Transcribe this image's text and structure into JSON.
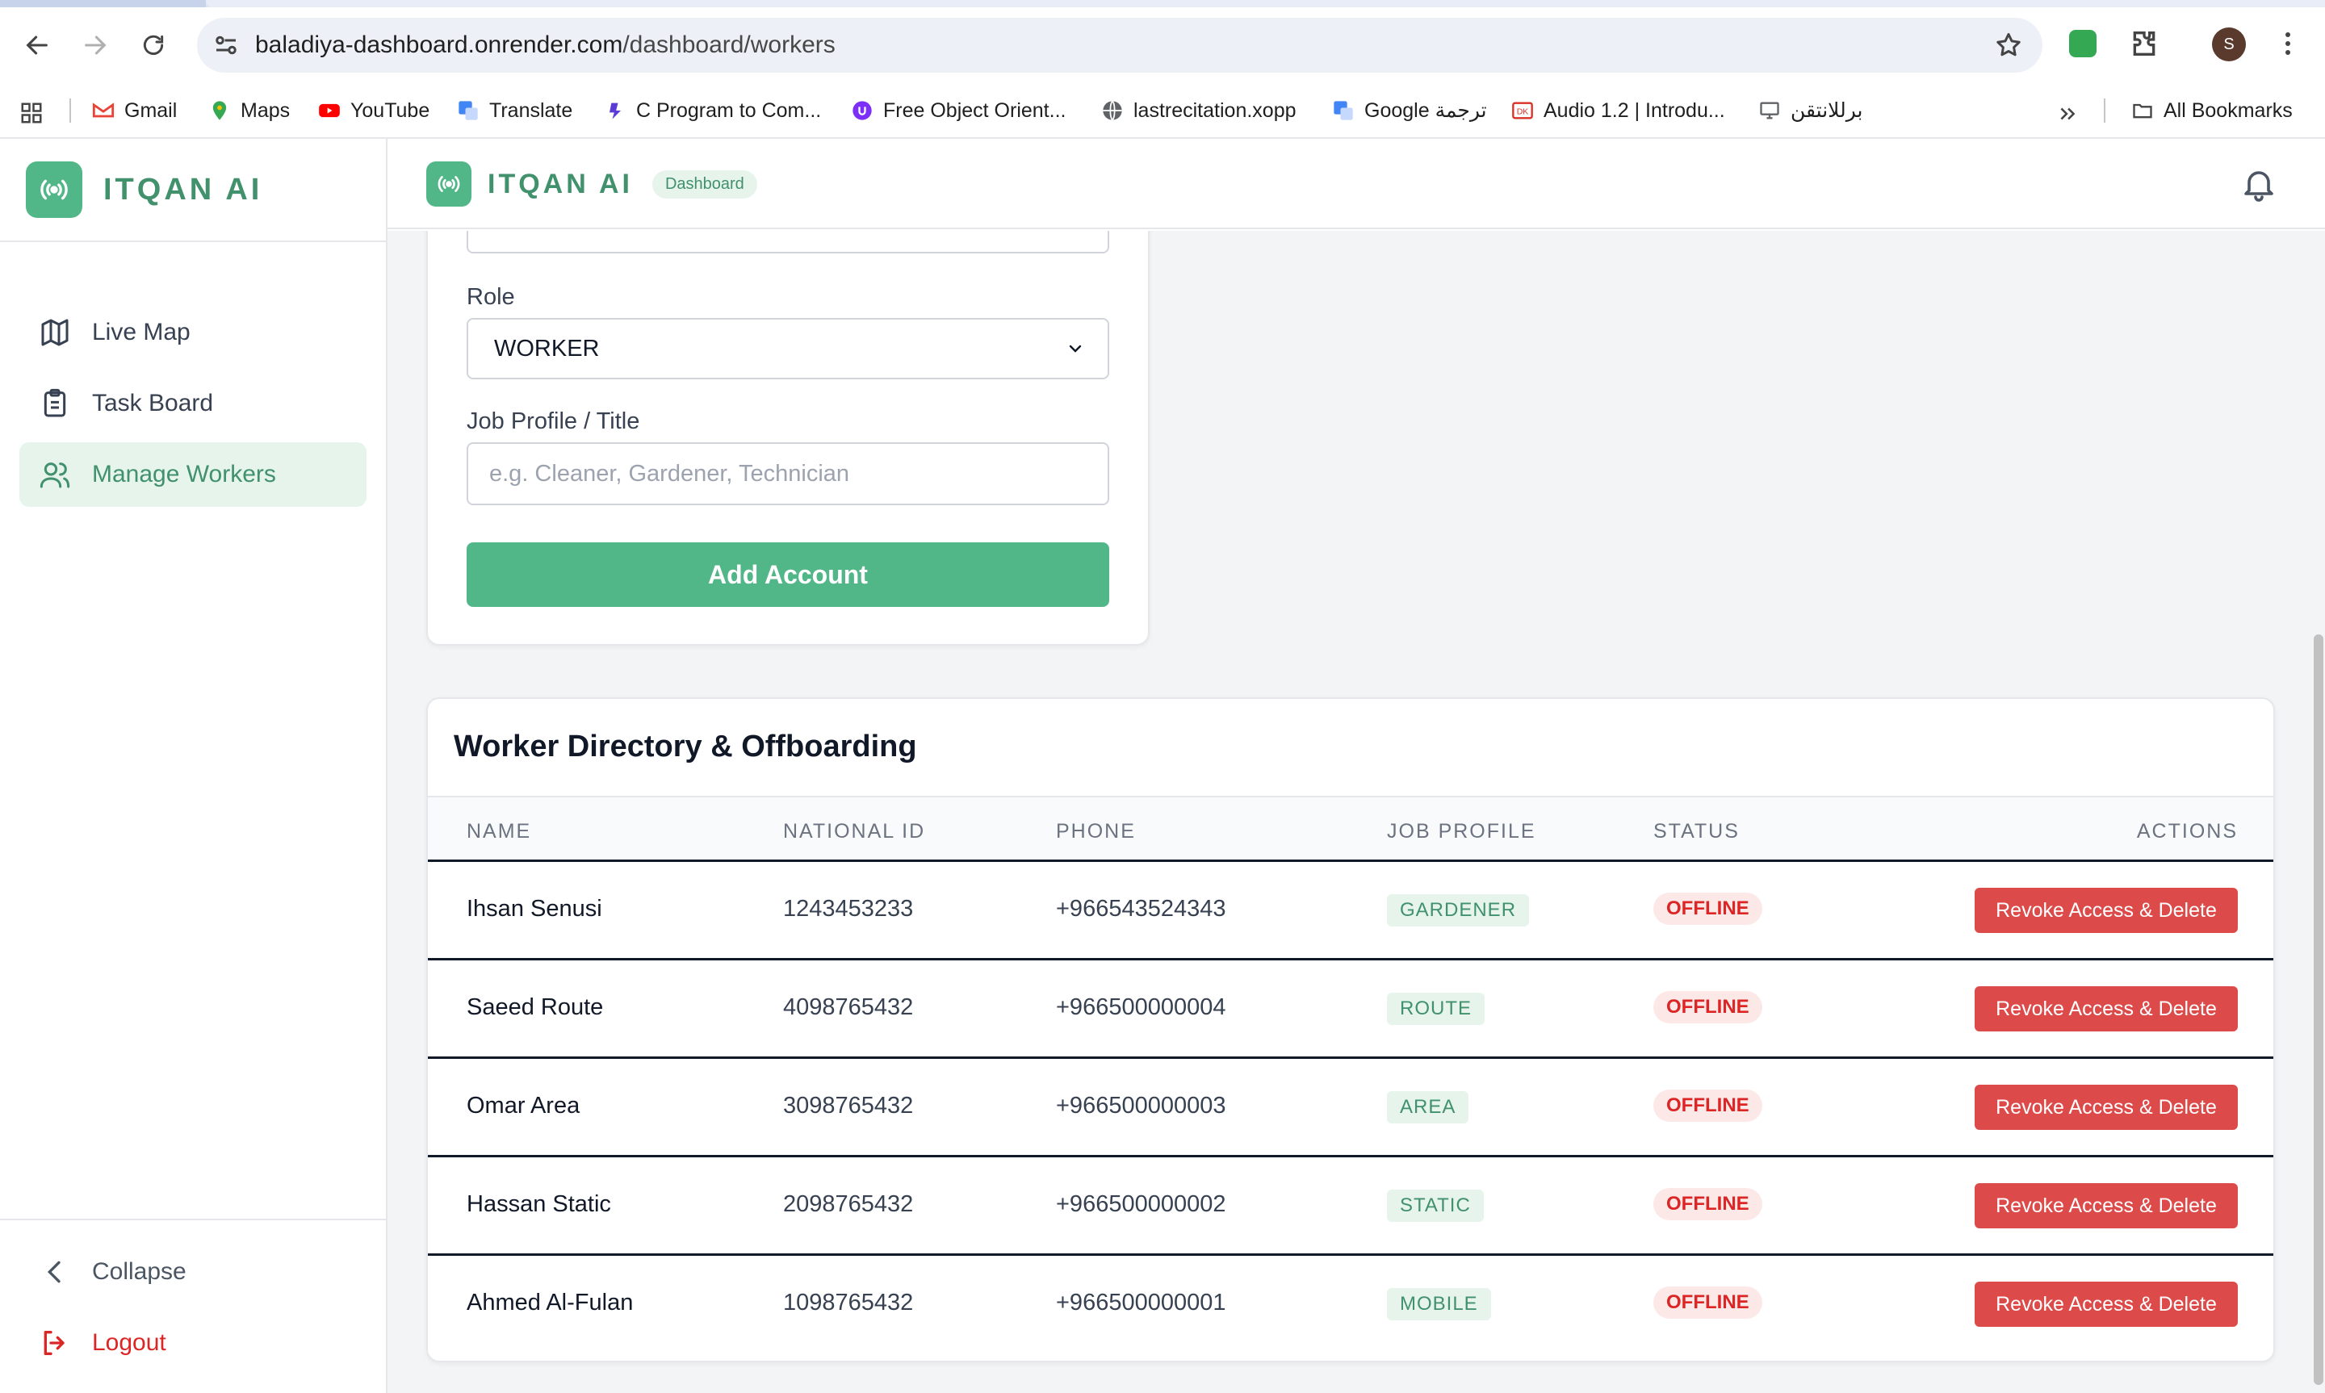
{
  "browser": {
    "url_host": "baladiya-dashboard.onrender.com",
    "url_path": "/dashboard/workers",
    "profile_initial": "S",
    "bookmarks": [
      {
        "label": "Gmail",
        "icon": "gmail-icon",
        "color": "#ea4335"
      },
      {
        "label": "Maps",
        "icon": "maps-icon",
        "color": "#34a853"
      },
      {
        "label": "YouTube",
        "icon": "youtube-icon",
        "color": "#ff0000"
      },
      {
        "label": "Translate",
        "icon": "translate-icon",
        "color": "#4285f4"
      },
      {
        "label": "C Program to Com...",
        "icon": "bookmark-favicon",
        "color": "#5b3bd6"
      },
      {
        "label": "Free Object Orient...",
        "icon": "bookmark-favicon",
        "color": "#7b2ff7"
      },
      {
        "label": "lastrecitation.xopp",
        "icon": "globe-icon",
        "color": "#5f6368"
      },
      {
        "label": "Google ترجمة",
        "icon": "translate-icon",
        "color": "#4285f4"
      },
      {
        "label": "Audio 1.2 | Introdu...",
        "icon": "bookmark-favicon",
        "color": "#d93025"
      },
      {
        "label": "برللانتقن",
        "icon": "monitor-icon",
        "color": "#5f6368"
      }
    ],
    "all_bookmarks_label": "All Bookmarks"
  },
  "brand": {
    "name": "ITQAN AI",
    "badge": "Dashboard",
    "accent": "#52b788",
    "accent_text": "#40916c"
  },
  "sidebar": {
    "items": [
      {
        "label": "Live Map",
        "icon": "map-icon",
        "active": false
      },
      {
        "label": "Task Board",
        "icon": "clipboard-icon",
        "active": false
      },
      {
        "label": "Manage Workers",
        "icon": "users-icon",
        "active": true
      }
    ],
    "collapse_label": "Collapse",
    "logout_label": "Logout"
  },
  "form": {
    "role_label": "Role",
    "role_value": "WORKER",
    "job_label": "Job Profile / Title",
    "job_placeholder": "e.g. Cleaner, Gardener, Technician",
    "submit_label": "Add Account"
  },
  "directory": {
    "title": "Worker Directory & Offboarding",
    "columns": [
      "NAME",
      "NATIONAL ID",
      "PHONE",
      "JOB PROFILE",
      "STATUS",
      "ACTIONS"
    ],
    "rows": [
      {
        "name": "Ihsan Senusi",
        "national_id": "1243453233",
        "phone": "+966543524343",
        "job": "GARDENER",
        "status": "OFFLINE",
        "action": "Revoke Access & Delete"
      },
      {
        "name": "Saeed Route",
        "national_id": "4098765432",
        "phone": "+966500000004",
        "job": "ROUTE",
        "status": "OFFLINE",
        "action": "Revoke Access & Delete"
      },
      {
        "name": "Omar Area",
        "national_id": "3098765432",
        "phone": "+966500000003",
        "job": "AREA",
        "status": "OFFLINE",
        "action": "Revoke Access & Delete"
      },
      {
        "name": "Hassan Static",
        "national_id": "2098765432",
        "phone": "+966500000002",
        "job": "STATIC",
        "status": "OFFLINE",
        "action": "Revoke Access & Delete"
      },
      {
        "name": "Ahmed Al-Fulan",
        "national_id": "1098765432",
        "phone": "+966500000001",
        "job": "MOBILE",
        "status": "OFFLINE",
        "action": "Revoke Access & Delete"
      }
    ],
    "status_color": "#dc2626",
    "danger_button_color": "#dc4a4a"
  }
}
